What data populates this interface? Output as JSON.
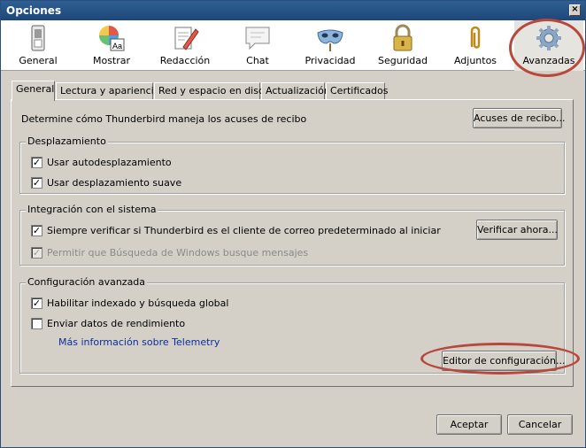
{
  "window": {
    "title": "Opciones",
    "close_symbol": "×"
  },
  "toolbar": {
    "items": [
      {
        "label": "General",
        "icon": "switch-icon"
      },
      {
        "label": "Mostrar",
        "icon": "color-wheel-font-icon"
      },
      {
        "label": "Redacción",
        "icon": "compose-pencil-icon"
      },
      {
        "label": "Chat",
        "icon": "speech-bubble-icon"
      },
      {
        "label": "Privacidad",
        "icon": "mask-icon"
      },
      {
        "label": "Seguridad",
        "icon": "padlock-icon"
      },
      {
        "label": "Adjuntos",
        "icon": "paperclip-icon"
      },
      {
        "label": "Avanzadas",
        "icon": "gear-icon",
        "selected": true
      }
    ]
  },
  "tabs": [
    "General",
    "Lectura y apariencia",
    "Red y espacio en disco",
    "Actualización",
    "Certificados"
  ],
  "general": {
    "receipts_text": "Determine cómo Thunderbird maneja los acuses de recibo",
    "receipts_button": "Acuses de recibo...",
    "scrolling": {
      "title": "Desplazamiento",
      "autoscroll_label": "Usar autodesplazamiento",
      "autoscroll_checked": true,
      "smooth_label": "Usar desplazamiento suave",
      "smooth_checked": true
    },
    "system": {
      "title": "Integración con el sistema",
      "default_client_label": "Siempre verificar si Thunderbird es el cliente de correo predeterminado al iniciar",
      "default_client_checked": true,
      "verify_button": "Verificar ahora...",
      "windows_search_label": "Permitir que Búsqueda de Windows busque mensajes",
      "windows_search_checked": true,
      "windows_search_disabled": true
    },
    "advanced_config": {
      "title": "Configuración avanzada",
      "indexing_label": "Habilitar indexado y búsqueda global",
      "indexing_checked": true,
      "telemetry_label": "Enviar datos de rendimiento",
      "telemetry_checked": false,
      "telemetry_link": "Más información sobre Telemetry",
      "config_editor_button": "Editor de configuración..."
    }
  },
  "footer": {
    "accept": "Aceptar",
    "cancel": "Cancelar"
  },
  "colors": {
    "title_bar": "#1e4778",
    "annotation_ring": "#b8473c",
    "link": "#0b2f9b"
  }
}
